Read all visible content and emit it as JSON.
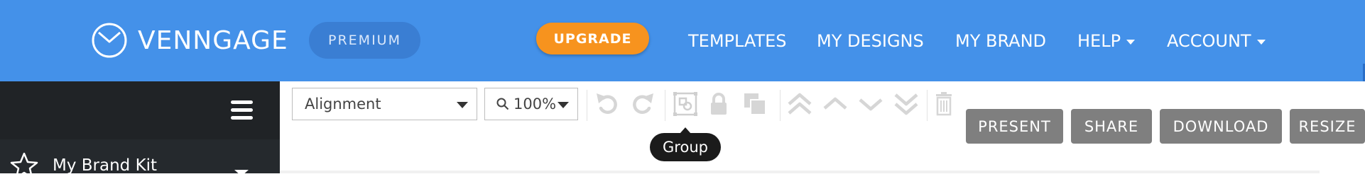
{
  "header": {
    "logo_text": "VENNGAGE",
    "plan_badge": "PREMIUM",
    "upgrade_label": "UPGRADE",
    "nav": [
      {
        "label": "TEMPLATES"
      },
      {
        "label": "MY DESIGNS"
      },
      {
        "label": "MY BRAND"
      },
      {
        "label": "HELP"
      },
      {
        "label": "ACCOUNT"
      }
    ]
  },
  "sidebar": {
    "brand_kit_label": "My Brand Kit"
  },
  "toolbar": {
    "alignment_value": "Alignment",
    "zoom_value": "100%",
    "tooltip": "Group",
    "icons": [
      "undo-icon",
      "redo-icon",
      "group-icon",
      "lock-icon",
      "duplicate-icon",
      "bring-to-front-icon",
      "bring-forward-icon",
      "send-backward-icon",
      "send-to-back-icon",
      "trash-icon"
    ]
  },
  "actions": {
    "present": "PRESENT",
    "share": "SHARE",
    "download": "DOWNLOAD",
    "resize": "RESIZE"
  },
  "colors": {
    "header_bg": "#4491e9",
    "upgrade_bg": "#f7931e",
    "sidebar_bg": "#25292d",
    "action_button_bg": "#7f7f7f"
  }
}
